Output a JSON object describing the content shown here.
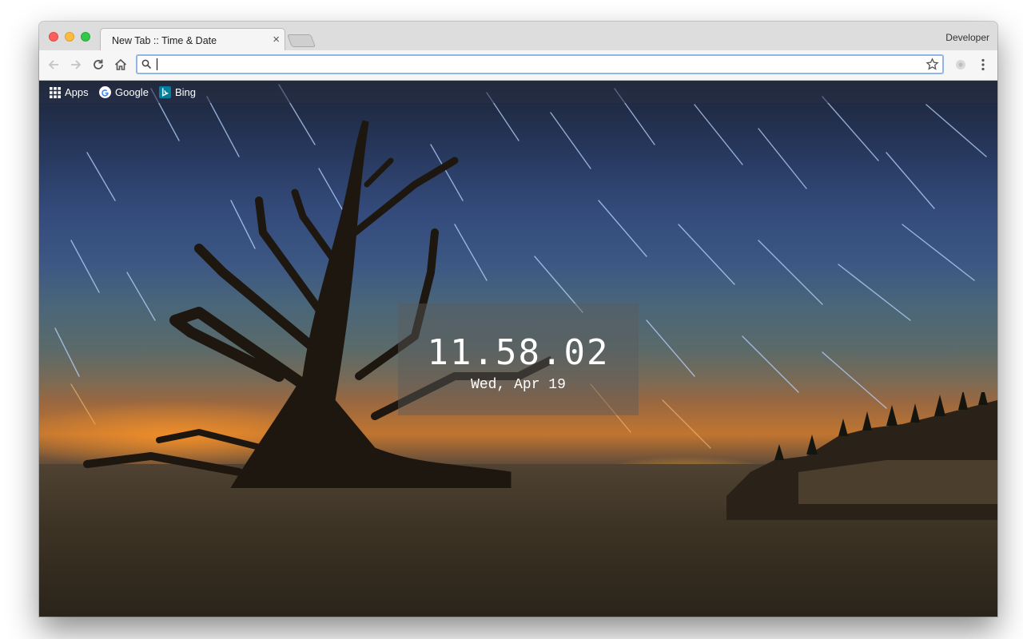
{
  "window": {
    "profile_name": "Developer"
  },
  "tabs": [
    {
      "title": "New Tab :: Time & Date"
    }
  ],
  "toolbar": {
    "address_value": ""
  },
  "bookmarks": [
    {
      "label": "Apps",
      "icon": "apps-grid-icon"
    },
    {
      "label": "Google",
      "icon": "google-icon"
    },
    {
      "label": "Bing",
      "icon": "bing-icon"
    }
  ],
  "clock": {
    "time": "11.58.02",
    "date": "Wed, Apr 19"
  },
  "colors": {
    "omnibox_focus": "#8eb6e6",
    "traffic_close": "#fc605c",
    "traffic_min": "#fdbc40",
    "traffic_max": "#34c84a"
  }
}
